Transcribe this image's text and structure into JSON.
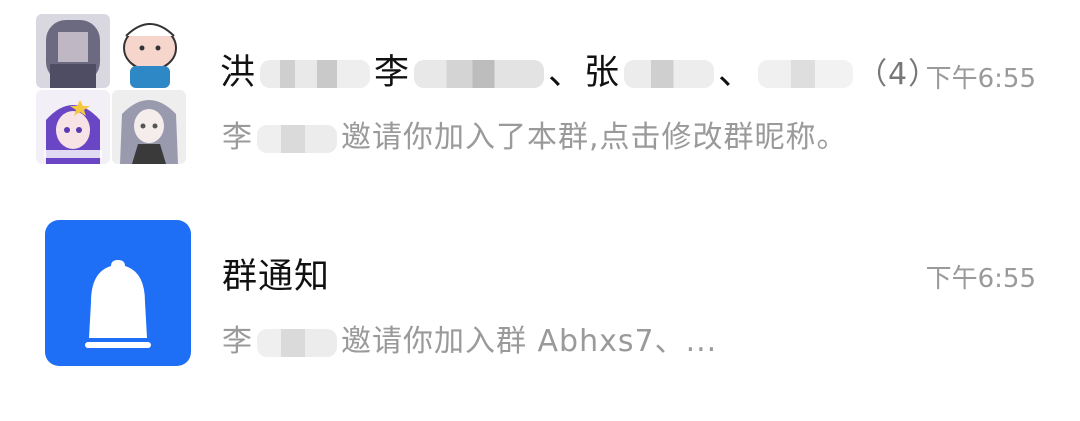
{
  "chats": [
    {
      "title_prefix": "洪",
      "title_part2": "李",
      "title_part3": "、张",
      "title_part4": "、",
      "member_count": "（4）",
      "time": "下午6:55",
      "preview_prefix": "李",
      "preview_text": "邀请你加入了本群,点击修改群昵称。",
      "avatar_icon": "group-avatar"
    },
    {
      "title": "群通知",
      "time": "下午6:55",
      "preview_prefix": "李",
      "preview_text": "邀请你加入群 Abhxs7、...",
      "avatar_icon": "bell-icon",
      "avatar_color": "#1e6ff5"
    }
  ]
}
